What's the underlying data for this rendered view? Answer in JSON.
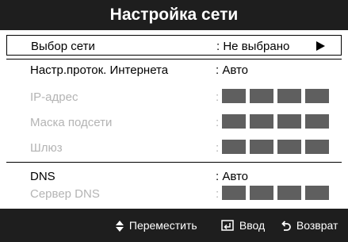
{
  "title": "Настройка сети",
  "rows": [
    {
      "label": "Выбор сети",
      "value": ": Не выбрано"
    },
    {
      "label": "Настр.проток. Интернета",
      "value": ": Авто"
    },
    {
      "label": "IP-адрес",
      "value": ":"
    },
    {
      "label": "Маска подсети",
      "value": ":"
    },
    {
      "label": "Шлюз",
      "value": ":"
    },
    {
      "label": "DNS",
      "value": ": Авто"
    },
    {
      "label": "Сервер DNS",
      "value": ":"
    }
  ],
  "footer": {
    "move": "Переместить",
    "enter": "Ввод",
    "back": "Возврат"
  },
  "colors": {
    "bar": "#1e1e1e",
    "dim_text": "#b4b4b4",
    "field_box": "#5f5f5f"
  },
  "icons": [
    "up-down-arrows-icon",
    "enter-icon",
    "return-icon",
    "arrow-right-icon"
  ]
}
